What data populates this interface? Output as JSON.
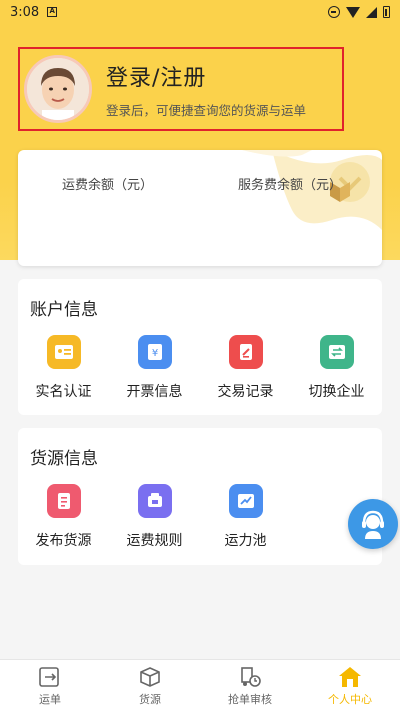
{
  "status_bar": {
    "time": "3:08",
    "notif_letter": "A"
  },
  "profile": {
    "title": "登录/注册",
    "subtitle": "登录后，可便捷查询您的货源与运单"
  },
  "balance": {
    "freight_label": "运费余额（元）",
    "service_label": "服务费余额（元）"
  },
  "account_section": {
    "title": "账户信息",
    "items": [
      {
        "label": "实名认证",
        "icon": "id-card-icon",
        "color": "#f6b926"
      },
      {
        "label": "开票信息",
        "icon": "invoice-icon",
        "color": "#4b8ef0"
      },
      {
        "label": "交易记录",
        "icon": "record-icon",
        "color": "#ee4d4d"
      },
      {
        "label": "切换企业",
        "icon": "switch-icon",
        "color": "#3fb58a"
      }
    ]
  },
  "goods_section": {
    "title": "货源信息",
    "items": [
      {
        "label": "发布货源",
        "icon": "publish-icon",
        "color": "#ef5a6f"
      },
      {
        "label": "运费规则",
        "icon": "rules-icon",
        "color": "#7a6ff0"
      },
      {
        "label": "运力池",
        "icon": "capacity-icon",
        "color": "#4b8ef0"
      }
    ]
  },
  "tabs": [
    {
      "label": "运单",
      "icon": "waybill-icon"
    },
    {
      "label": "货源",
      "icon": "goods-box-icon"
    },
    {
      "label": "抢单审核",
      "icon": "truck-review-icon"
    },
    {
      "label": "个人中心",
      "icon": "home-icon",
      "active": true
    }
  ],
  "colors": {
    "accent": "#fbd24b",
    "active_tab": "#f5b800",
    "highlight_border": "#e0222c",
    "support": "#3d98e6"
  }
}
